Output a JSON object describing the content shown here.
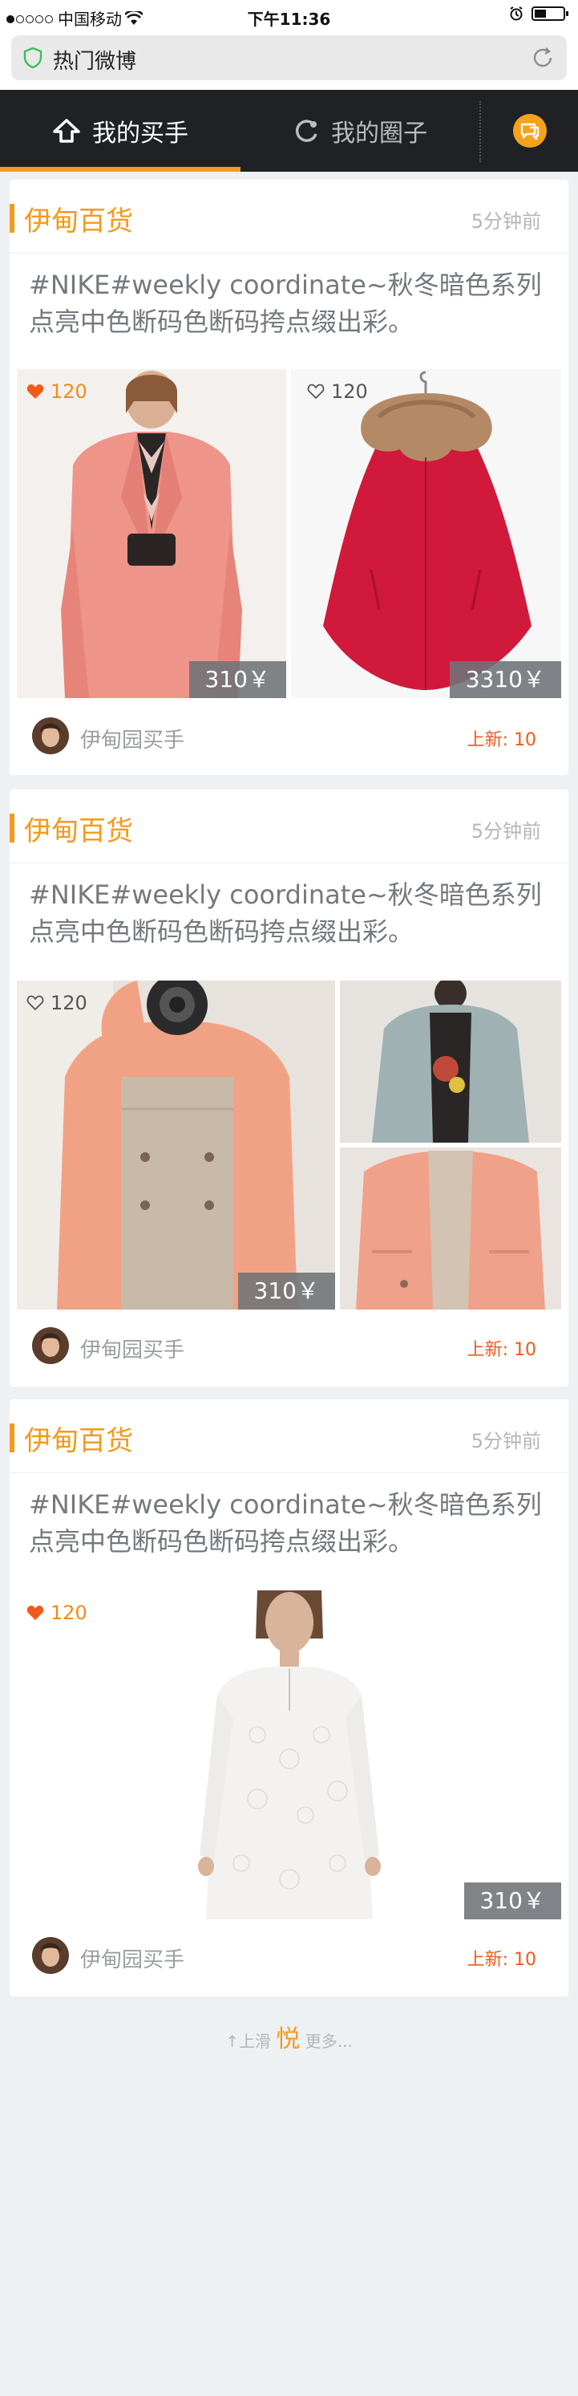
{
  "status_bar": {
    "carrier": "中国移动",
    "time": "下午11:36"
  },
  "address_bar": {
    "page_title": "热门微博"
  },
  "tabs": [
    {
      "label": "我的买手"
    },
    {
      "label": "我的圈子"
    }
  ],
  "colors": {
    "accent": "#f39a1a",
    "tabbar_bg": "#1f2125",
    "update_text": "#f05a1a"
  },
  "feed": [
    {
      "shop": "伊甸百货",
      "time_ago": "5分钟前",
      "description": "#NIKE#weekly coordinate~秋冬暗色系列点亮中色断码色断码挎点缀出彩。",
      "images": [
        {
          "subject": "woman in pink wool coat",
          "likes": "120",
          "liked": true,
          "price": "310￥"
        },
        {
          "subject": "red cape coat with fur collar",
          "likes": "120",
          "liked": false,
          "price": "3310￥"
        }
      ],
      "author": "伊甸园买手",
      "update": "上新: 10"
    },
    {
      "shop": "伊甸百货",
      "time_ago": "5分钟前",
      "description": "#NIKE#weekly coordinate~秋冬暗色系列点亮中色断码色断码挎点缀出彩。",
      "images": [
        {
          "subject": "woman in peach hooded jacket with camera",
          "likes": "120",
          "liked": false,
          "price": "310￥"
        },
        {
          "subject": "grey-blue hooded jacket"
        },
        {
          "subject": "peach hooded jacket close-up"
        }
      ],
      "author": "伊甸园买手",
      "update": "上新: 10"
    },
    {
      "shop": "伊甸百货",
      "time_ago": "5分钟前",
      "description": "#NIKE#weekly coordinate~秋冬暗色系列点亮中色断码色断码挎点缀出彩。",
      "images": [
        {
          "subject": "woman in white lace dress",
          "likes": "120",
          "liked": true,
          "price": "310￥"
        }
      ],
      "author": "伊甸园买手",
      "update": "上新: 10"
    }
  ],
  "load_more": {
    "prefix": "↑上滑",
    "logo": "悦",
    "suffix": "更多..."
  }
}
